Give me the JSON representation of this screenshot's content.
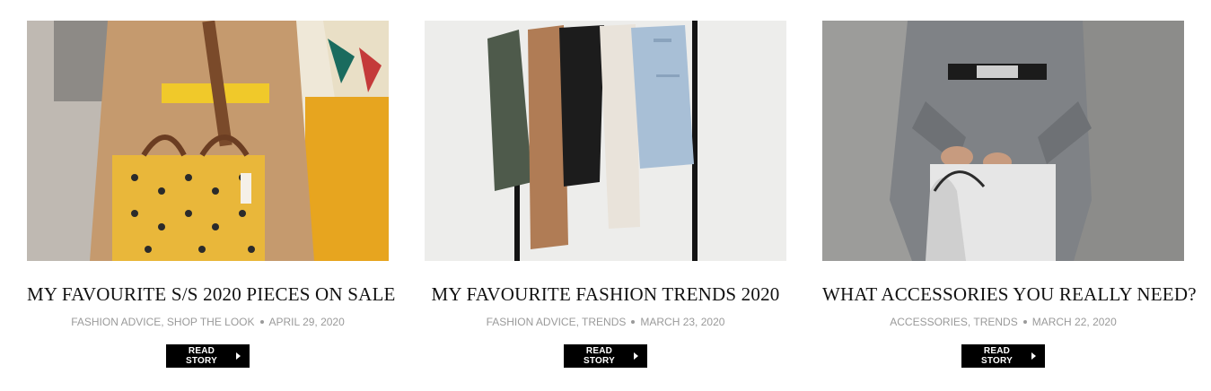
{
  "posts": [
    {
      "title": "MY FAVOURITE S/S 2020 PIECES ON SALE",
      "categories": "FASHION ADVICE, SHOP THE LOOK",
      "date": "APRIL 29, 2020",
      "read_label": "READ STORY",
      "image_alt": "woman with yellow tote bag"
    },
    {
      "title": "MY FAVOURITE FASHION TRENDS 2020",
      "categories": "FASHION ADVICE, TRENDS",
      "date": "MARCH 23, 2020",
      "read_label": "READ STORY",
      "image_alt": "jackets on clothing rack"
    },
    {
      "title": "WHAT ACCESSORIES YOU REALLY NEED?",
      "categories": "ACCESSORIES, TRENDS",
      "date": "MARCH 22, 2020",
      "read_label": "READ STORY",
      "image_alt": "woman holding white handbag"
    }
  ],
  "colors": {
    "button_bg": "#000000",
    "meta_text": "#9a9a9a",
    "title_text": "#111111"
  }
}
